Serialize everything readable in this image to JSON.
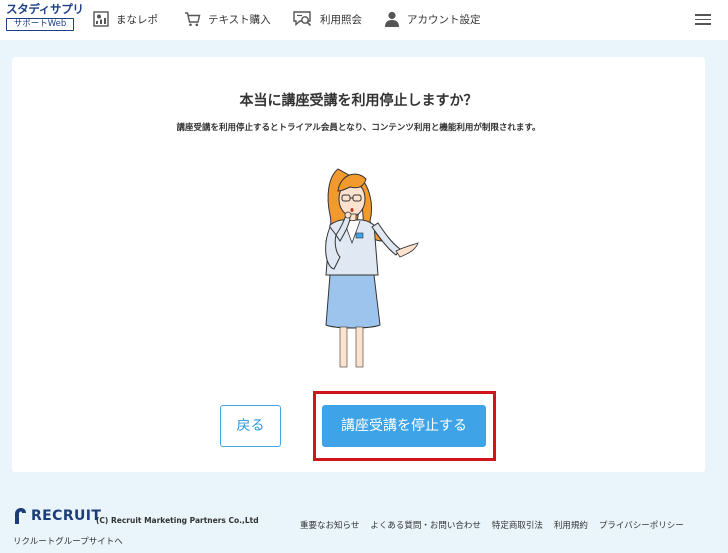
{
  "header": {
    "logo_main": "スタディサプリ",
    "logo_sub": "サポートWeb",
    "nav": [
      {
        "label": "まなレポ",
        "icon": "report-icon"
      },
      {
        "label": "テキスト購入",
        "icon": "cart-icon"
      },
      {
        "label": "利用照会",
        "icon": "search-chat-icon"
      },
      {
        "label": "アカウント設定",
        "icon": "user-icon"
      }
    ],
    "menu_icon": "hamburger-menu-icon"
  },
  "dialog": {
    "title": "本当に講座受講を利用停止しますか？",
    "description": "講座受講を利用停止するとトライアル会員となり、コンテンツ利用と機能利用が制限されます。",
    "back_label": "戻る",
    "stop_label": "講座受講を停止する",
    "highlight_color": "#d0161c",
    "accent_color": "#3fa3e8"
  },
  "footer": {
    "brand": "RECRUIT",
    "copyright": "(C) Recruit Marketing Partners Co.,Ltd",
    "group_link": "リクルートグループサイトへ",
    "links": [
      "重要なお知らせ",
      "よくある質問・お問い合わせ",
      "特定商取引法",
      "利用規約",
      "プライバシーポリシー"
    ]
  }
}
